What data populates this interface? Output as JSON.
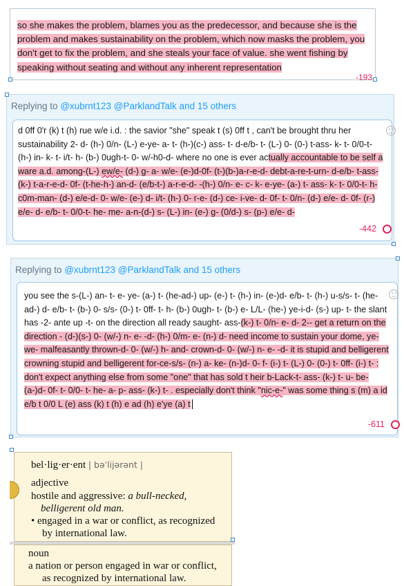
{
  "panel1": {
    "text": "so she makes the problem, blames you as the predecessor, and because she is the problem and makes sustainability on the problem, which now masks the problem, you don't get to fix the problem, and she steals your face of value. she went fishing by speaking without seating and without any inherent representation",
    "count": "-193"
  },
  "reply1": {
    "replying_prefix": "Replying to",
    "users": "@xubrnt123 @ParklandTalk and 15 others",
    "text_plain": "d 0ff 0'r (k) t (h) rue w/e i.d. : the savior \"she\" speak t (s) 0ff t , can't be brought thru her sustainability 2- d- (h-) 0/n- (L-) e-ye- a- t- (h-)(c-) ass- t- d-e/b- t- (L-) 0- (0-) t-ass- k- t- 0/0-t- (h-) in- k- t- i/t- h- (b-) 0ugh-t- 0- w/-h0-d- where no one is ever ac",
    "text_hl_a": "tually accountable to be self a ware a.d. among-(L-) ",
    "text_squig": "ew/e-",
    "text_hl_b": " (d-) g- a- w/e- (e-)d-0f- (t-)(b-)a-r-e-d- debt-a-re-t-urn- d-e/b- t-ass- (k-) t-a-r-e-d- 0f- (t-he-h-) an-d- (e/b-t-) a-r-e-d- -(h-) 0/n- e- c- k- e-ye- (a-) t- ass- k- t- 0/0-t- h-c0m-man- (d-) e/e-d- 0- w/e- (e-) d- i/t- (h-) 0- r-e- (d-) ce- i-ve- d- 0f- t- 0/n- (d-) e/e- d- 0f- (r-) e/e- d- e/b- t- 0/0-t- he- me- a-n-(d-) s- (L-) in- (e-) g- (0/d-) s- (p-) e/e- d-",
    "count": "-442"
  },
  "reply2": {
    "replying_prefix": "Replying to",
    "users": "@xubrnt123 @ParklandTalk and 15 others",
    "text_plain": "you see the s-(L-) an- t- e- ye- (a-) t- (he-ad-) up- (e-) t- (h-) in- (e-)d- e/b- t- (h-) u-s/s- t- (he-ad-) d- e/b- t- (b-) 0- s/s- (0-) t- 0ff- t- h- (b-) 0ugh- t- (b-) e- L/L- (he-) ye-i-d- (s-) up- t- the slant has -2- ante up -t- on the direction all ready saught- ass-",
    "text_hl": "(k-) t- 0/n- e- d- 2-- get a return on the direction - (d-)(s-) 0- (w/-) n- e- -d- (h-) 0/m- e- (n-) d- need income to sustain your dome, ye-we- malfeasantly thrown-d- 0- (w/-) h- and- crown-d- 0- (w/-) n- e- -d- it is stupid and belligerent crowning stupid and belligerent for-ce-s/s- (n-) a- ke- (n-)d- 0- f- (i-) t- (L-) 0- (0-) t- 0ff- (i-) t- : don't expect anything else from some \"one\" that has sold t heir b-Lack-t- ass- (k-) t- u- be- (a-)d- 0f- t- 0/0- t- he- a- p- ass- (k-) t- . especially don't think \"",
    "text_squig": "nic-e-",
    "text_hl_end": "\" was some thing s (m) a id e/b t 0/0 L (e) ass (k) t (h) e ad (h) e'ye (a) t",
    "count": "-611"
  },
  "dictionary": {
    "headword": "bel·lig·er·ent",
    "pronunciation": "| bəˈlijərənt |",
    "pos1": "adjective",
    "def1": "hostile and aggressive:",
    "ex1a": "a bull-necked,",
    "ex1b": "belligerent old man.",
    "bullet": "•",
    "def2a": "engaged in a war or conflict, as recognized",
    "def2b": "by international law.",
    "pos2": "noun",
    "def3a": "a nation or person engaged in war or conflict,",
    "def3b": "as recognized by international law."
  }
}
